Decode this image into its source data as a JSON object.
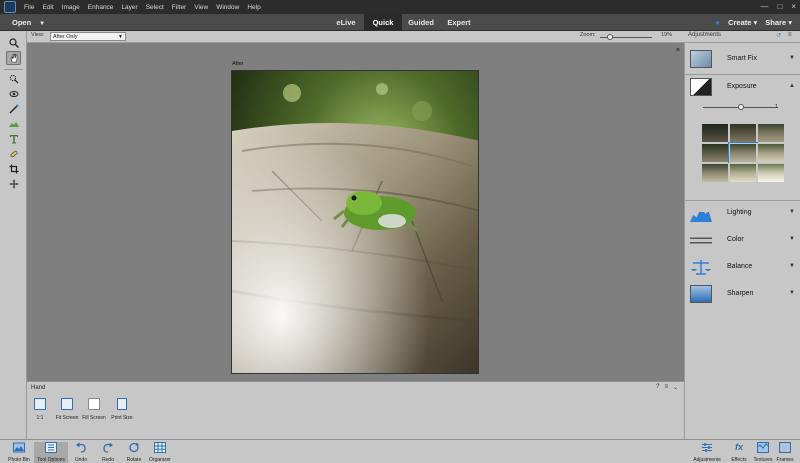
{
  "menu": [
    "File",
    "Edit",
    "Image",
    "Enhance",
    "Layer",
    "Select",
    "Filter",
    "View",
    "Window",
    "Help"
  ],
  "window_controls": [
    "—",
    "□",
    "×"
  ],
  "mode_bar": {
    "open_label": "Open",
    "tabs": [
      "eLive",
      "Quick",
      "Guided",
      "Expert"
    ],
    "active_tab": "Quick",
    "create_label": "Create",
    "share_label": "Share"
  },
  "options_bar": {
    "view_label": "View:",
    "view_value": "After Only",
    "zoom_label": "Zoom:",
    "zoom_value": "19%",
    "zoom_fraction": 0.19
  },
  "canvas": {
    "after_label": "After",
    "close_icon": "×"
  },
  "tool_options": {
    "title": "Hand",
    "buttons": [
      "1:1",
      "Fit Screen",
      "Fill Screen",
      "Print Size"
    ]
  },
  "adjustments": {
    "title": "Adjustments",
    "items": [
      {
        "label": "Smart Fix",
        "expanded": false
      },
      {
        "label": "Exposure",
        "expanded": true
      },
      {
        "label": "Lighting",
        "expanded": false
      },
      {
        "label": "Color",
        "expanded": false
      },
      {
        "label": "Balance",
        "expanded": false
      },
      {
        "label": "Sharpen",
        "expanded": false
      }
    ],
    "exposure_value": "1",
    "exposure_fraction": 0.5
  },
  "bottom_bar": {
    "left": [
      "Photo Bin",
      "Tool Options",
      "Undo",
      "Redo",
      "Rotate",
      "Organizer"
    ],
    "right": [
      "Adjustments",
      "Effects",
      "Textures",
      "Frames"
    ]
  },
  "colors": {
    "accent": "#2f7fd8",
    "panel": "#c7c7c7",
    "canvas": "#7f7f7f",
    "dark_bar": "#2c2c2c"
  }
}
